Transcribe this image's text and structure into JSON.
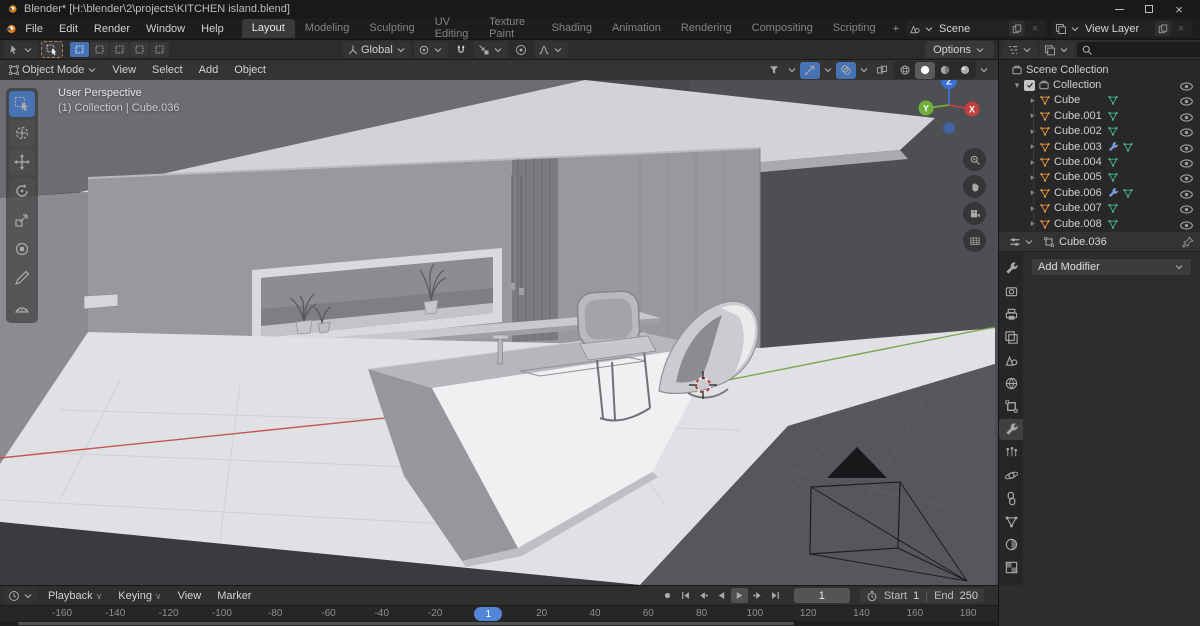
{
  "titlebar": {
    "title": "Blender* [H:\\blender\\2\\projects\\KITCHEN island.blend]"
  },
  "topbar": {
    "menus": [
      "File",
      "Edit",
      "Render",
      "Window",
      "Help"
    ],
    "workspaces": [
      "Layout",
      "Modeling",
      "Sculpting",
      "UV Editing",
      "Texture Paint",
      "Shading",
      "Animation",
      "Rendering",
      "Compositing",
      "Scripting"
    ],
    "active_workspace": "Layout",
    "new_workspace_label": "+",
    "scene": {
      "value": "Scene"
    },
    "view_layer": {
      "value": "View Layer"
    }
  },
  "tool_settings": {
    "orientation": "Global",
    "options_label": "Options",
    "select_modes": [
      "set",
      "extend",
      "subtract",
      "invert",
      "intersect"
    ],
    "active_select_mode": "set"
  },
  "outliner": {
    "search_placeholder": "",
    "root": "Scene Collection",
    "collection": {
      "name": "Collection"
    },
    "items": [
      {
        "name": "Cube",
        "icons": [
          "mesh-data"
        ]
      },
      {
        "name": "Cube.001",
        "icons": [
          "mesh-data"
        ]
      },
      {
        "name": "Cube.002",
        "icons": [
          "mesh-data"
        ]
      },
      {
        "name": "Cube.003",
        "icons": [
          "wrench",
          "mesh-data"
        ]
      },
      {
        "name": "Cube.004",
        "icons": [
          "mesh-data"
        ]
      },
      {
        "name": "Cube.005",
        "icons": [
          "mesh-data"
        ]
      },
      {
        "name": "Cube.006",
        "icons": [
          "wrench",
          "mesh-data"
        ]
      },
      {
        "name": "Cube.007",
        "icons": [
          "mesh-data"
        ]
      },
      {
        "name": "Cube.008",
        "icons": [
          "mesh-data"
        ]
      }
    ]
  },
  "viewport": {
    "mode": "Object Mode",
    "menus": [
      "View",
      "Select",
      "Add",
      "Object"
    ],
    "overlay": {
      "line1": "User Perspective",
      "line2": "(1) Collection | Cube.036"
    },
    "gizmo_axes": {
      "x": "X",
      "y": "Y",
      "z": "Z"
    },
    "header_icons": [
      "object-types-visibility",
      "gizmos",
      "overlays",
      "xray",
      "shading-wireframe",
      "shading-solid",
      "shading-material",
      "shading-rendered"
    ],
    "nav_buttons": [
      "zoom",
      "pan",
      "camera-view",
      "toggle-ortho"
    ]
  },
  "toolbar": {
    "tools": [
      "select-box",
      "cursor",
      "move",
      "rotate",
      "scale",
      "transform",
      "annotate",
      "measure"
    ],
    "active": "select-box"
  },
  "properties": {
    "breadcrumb": "Cube.036",
    "add_modifier_label": "Add Modifier",
    "tabs": [
      "tool",
      "render",
      "output",
      "view-layer",
      "scene",
      "world",
      "object",
      "modifiers",
      "particles",
      "physics",
      "constraints",
      "data",
      "material",
      "texture"
    ],
    "active_tab": "modifiers"
  },
  "timeline": {
    "menus": [
      "Playback",
      "Keying",
      "View",
      "Marker"
    ],
    "playback_buttons": [
      "record",
      "jump-start",
      "prev-keyframe",
      "play-reverse",
      "play",
      "next-keyframe",
      "jump-end"
    ],
    "current_frame": "1",
    "start_label": "Start",
    "start_value": "1",
    "end_label": "End",
    "end_value": "250",
    "ticks": [
      "-160",
      "-140",
      "-120",
      "-100",
      "-80",
      "-60",
      "-40",
      "-20",
      "1",
      "20",
      "40",
      "60",
      "80",
      "100",
      "120",
      "140",
      "160",
      "180"
    ],
    "current_tick_index": 8
  },
  "colors": {
    "accent": "#4772b3",
    "playhead": "#5285d6",
    "mesh_orange": "#dd933f",
    "data_green": "#47b384",
    "modifier_blue": "#7e9fe2"
  }
}
